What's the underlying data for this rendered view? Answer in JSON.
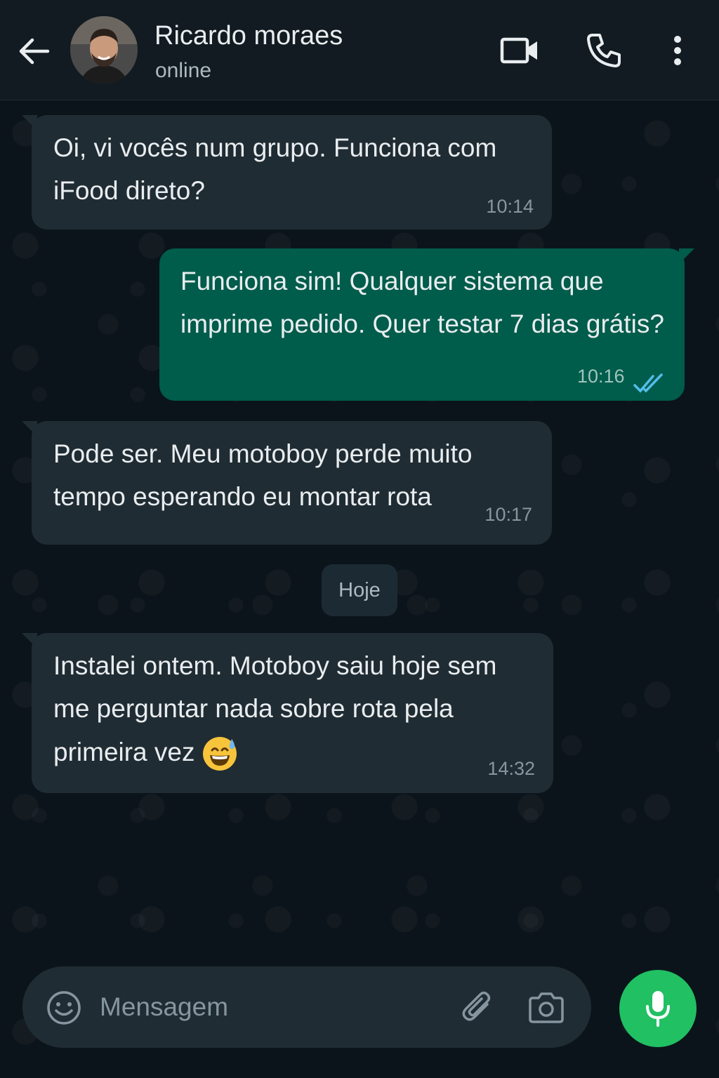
{
  "header": {
    "contact_name": "Ricardo moraes",
    "status": "online",
    "icons": [
      "back-arrow-icon",
      "video-call-icon",
      "voice-call-icon",
      "more-options-icon"
    ]
  },
  "messages": [
    {
      "direction": "incoming",
      "lines": [
        "Oi, vi vocês num grupo. Funciona com",
        "iFood direto?"
      ],
      "time": "10:14"
    },
    {
      "direction": "outgoing",
      "lines": [
        "Funciona sim! Qualquer sistema que",
        "imprime pedido. Quer testar 7 dias grátis?"
      ],
      "time": "10:16",
      "ticks": "read"
    },
    {
      "direction": "incoming",
      "lines": [
        "Pode ser. Meu motoboy perde muito",
        "tempo esperando eu montar rota"
      ],
      "time": "10:17"
    },
    {
      "direction": "incoming",
      "lines": [
        "Instalei ontem. Motoboy saiu hoje sem",
        "me perguntar nada sobre rota pela",
        "primeira vez"
      ],
      "time": "14:32",
      "emoji": "grinning-sweat-emoji"
    }
  ],
  "date_separator": "Hoje",
  "composer": {
    "placeholder": "Mensagem",
    "icons": [
      "emoji-icon",
      "attach-icon",
      "camera-icon",
      "mic-icon"
    ]
  },
  "colors": {
    "background": "#0b141a",
    "header": "#111b21",
    "incoming_bubble": "#202c33",
    "outgoing_bubble": "#005c4b",
    "read_ticks": "#53bdeb",
    "mic_button": "#21c063"
  }
}
